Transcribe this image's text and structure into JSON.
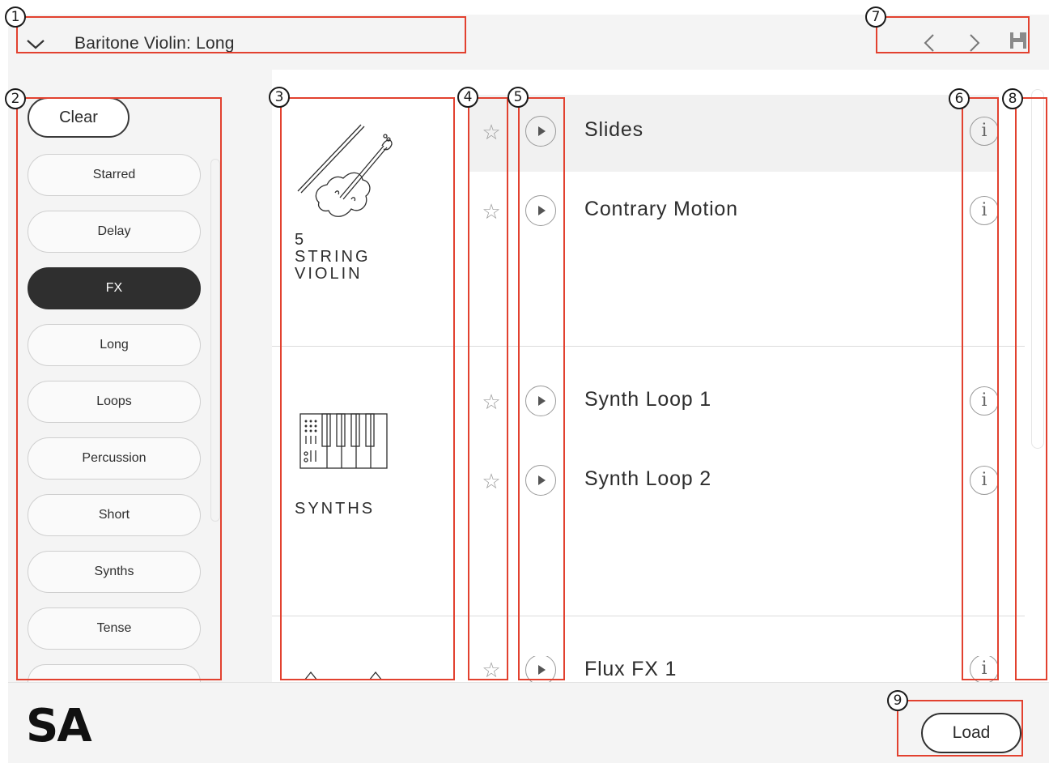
{
  "header": {
    "preset_title": "Baritone Violin: Long",
    "collapse_icon": "chevron-down-icon",
    "prev_icon": "chevron-left-icon",
    "next_icon": "chevron-right-icon",
    "save_icon": "save-icon"
  },
  "filters": {
    "clear_label": "Clear",
    "tags": [
      {
        "label": "Starred",
        "active": false
      },
      {
        "label": "Delay",
        "active": false
      },
      {
        "label": "FX",
        "active": true
      },
      {
        "label": "Long",
        "active": false
      },
      {
        "label": "Loops",
        "active": false
      },
      {
        "label": "Percussion",
        "active": false
      },
      {
        "label": "Short",
        "active": false
      },
      {
        "label": "Synths",
        "active": false
      },
      {
        "label": "Tense",
        "active": false
      }
    ]
  },
  "categories": [
    {
      "lines": [
        "5",
        "STRING",
        "VIOLIN"
      ],
      "icon": "violin-icon"
    },
    {
      "lines": [
        "SYNTHS"
      ],
      "icon": "synth-keyboard-icon"
    }
  ],
  "presets": [
    {
      "name": "Slides",
      "highlighted": true
    },
    {
      "name": "Contrary Motion",
      "highlighted": false
    },
    {
      "name": "Synth Loop 1",
      "highlighted": false
    },
    {
      "name": "Synth Loop 2",
      "highlighted": false
    },
    {
      "name": "Flux FX 1",
      "highlighted": false
    }
  ],
  "footer": {
    "logo_text": "SA",
    "load_label": "Load"
  },
  "callouts": [
    "1",
    "2",
    "3",
    "4",
    "5",
    "6",
    "7",
    "8",
    "9"
  ],
  "colors": {
    "annotation": "#e2412f",
    "active_tag": "#2f2f2f",
    "panel_bg": "#f4f4f4"
  }
}
